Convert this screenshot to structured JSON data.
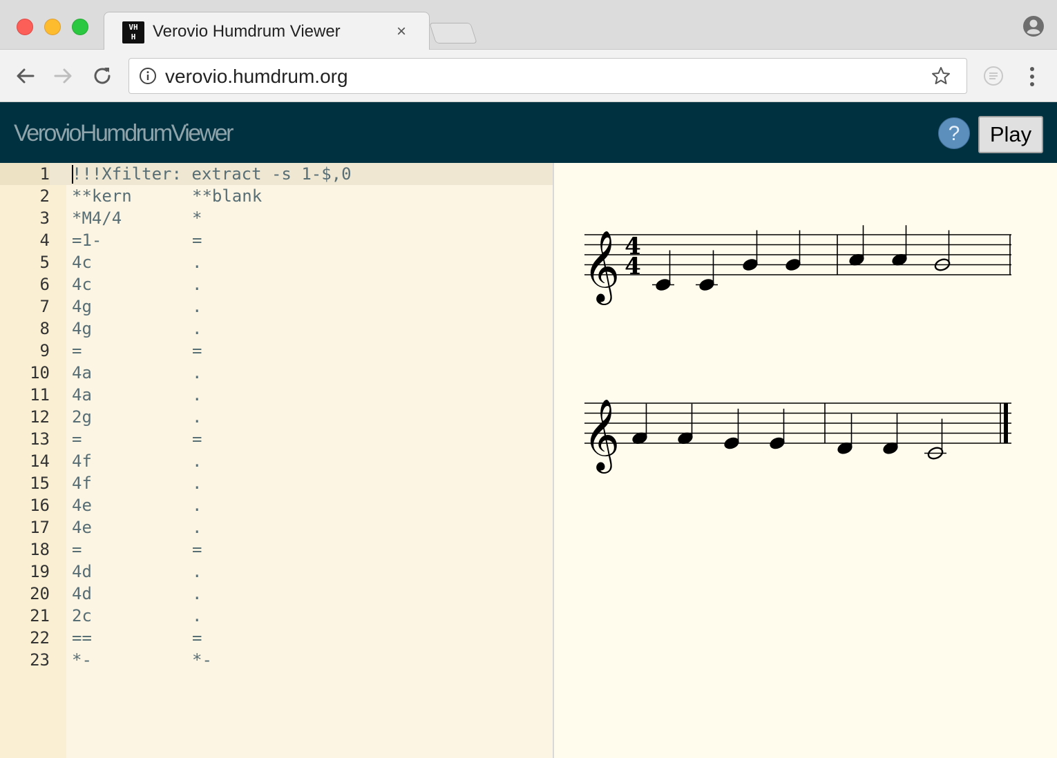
{
  "tab": {
    "title": "Verovio Humdrum Viewer",
    "favicon_text_top": "VH",
    "favicon_text_bottom": "H",
    "close_label": "×"
  },
  "omnibox": {
    "url": "verovio.humdrum.org"
  },
  "app": {
    "title": "VerovioHumdrumViewer",
    "help_label": "?",
    "play_label": "Play"
  },
  "editor": {
    "lines": [
      {
        "n": "1",
        "c1": "!!!Xfilter: extract -s 1-$,0",
        "c2": ""
      },
      {
        "n": "2",
        "c1": "**kern",
        "c2": "**blank"
      },
      {
        "n": "3",
        "c1": "*M4/4",
        "c2": "*"
      },
      {
        "n": "4",
        "c1": "=1-",
        "c2": "="
      },
      {
        "n": "5",
        "c1": "4c",
        "c2": "."
      },
      {
        "n": "6",
        "c1": "4c",
        "c2": "."
      },
      {
        "n": "7",
        "c1": "4g",
        "c2": "."
      },
      {
        "n": "8",
        "c1": "4g",
        "c2": "."
      },
      {
        "n": "9",
        "c1": "=",
        "c2": "="
      },
      {
        "n": "10",
        "c1": "4a",
        "c2": "."
      },
      {
        "n": "11",
        "c1": "4a",
        "c2": "."
      },
      {
        "n": "12",
        "c1": "2g",
        "c2": "."
      },
      {
        "n": "13",
        "c1": "=",
        "c2": "="
      },
      {
        "n": "14",
        "c1": "4f",
        "c2": "."
      },
      {
        "n": "15",
        "c1": "4f",
        "c2": "."
      },
      {
        "n": "16",
        "c1": "4e",
        "c2": "."
      },
      {
        "n": "17",
        "c1": "4e",
        "c2": "."
      },
      {
        "n": "18",
        "c1": "=",
        "c2": "="
      },
      {
        "n": "19",
        "c1": "4d",
        "c2": "."
      },
      {
        "n": "20",
        "c1": "4d",
        "c2": "."
      },
      {
        "n": "21",
        "c1": "2c",
        "c2": "."
      },
      {
        "n": "22",
        "c1": "==",
        "c2": "="
      },
      {
        "n": "23",
        "c1": "*-",
        "c2": "*-"
      }
    ],
    "active_line": 1
  },
  "notation": {
    "time_signature": {
      "top": "4",
      "bottom": "4"
    },
    "systems": [
      {
        "notes": [
          {
            "pitch": "c",
            "dur": "4"
          },
          {
            "pitch": "c",
            "dur": "4"
          },
          {
            "pitch": "g",
            "dur": "4"
          },
          {
            "pitch": "g",
            "dur": "4"
          },
          {
            "barline": "single"
          },
          {
            "pitch": "a",
            "dur": "4"
          },
          {
            "pitch": "a",
            "dur": "4"
          },
          {
            "pitch": "g",
            "dur": "2"
          },
          {
            "barline": "single"
          }
        ]
      },
      {
        "notes": [
          {
            "pitch": "f",
            "dur": "4"
          },
          {
            "pitch": "f",
            "dur": "4"
          },
          {
            "pitch": "e",
            "dur": "4"
          },
          {
            "pitch": "e",
            "dur": "4"
          },
          {
            "barline": "single"
          },
          {
            "pitch": "d",
            "dur": "4"
          },
          {
            "pitch": "d",
            "dur": "4"
          },
          {
            "pitch": "c",
            "dur": "2"
          },
          {
            "barline": "final"
          }
        ]
      }
    ]
  },
  "colors": {
    "app_header": "#003141",
    "editor_background": "#fdf5e3",
    "gutter_background": "#faefd2",
    "notation_background": "#fffbed",
    "code_text": "#586e75"
  }
}
